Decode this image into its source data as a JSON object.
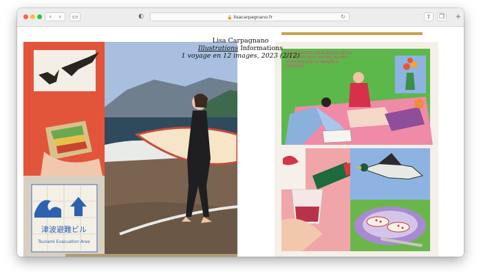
{
  "browser": {
    "url": "lisacarpagnano.fr",
    "back_icon": "chevron-left-icon",
    "forward_icon": "chevron-right-icon"
  },
  "site": {
    "author": "Lisa Carpagnano",
    "nav_illustrations": "Illustrations",
    "nav_informations": "Informations",
    "caption": "1 voyage en 12 images, 2023 (2/12)"
  },
  "artworks": {
    "left_sign_text": "津波避難ビル",
    "left_sign_subtext": "Tsunami Evacuation Area",
    "right_quote": "MARIE SAITEN LES PLANTES DE SA VIE ET LES PLUS BELLES FLEURS VIVANTES QUE LE MONDE A CONNUES"
  }
}
